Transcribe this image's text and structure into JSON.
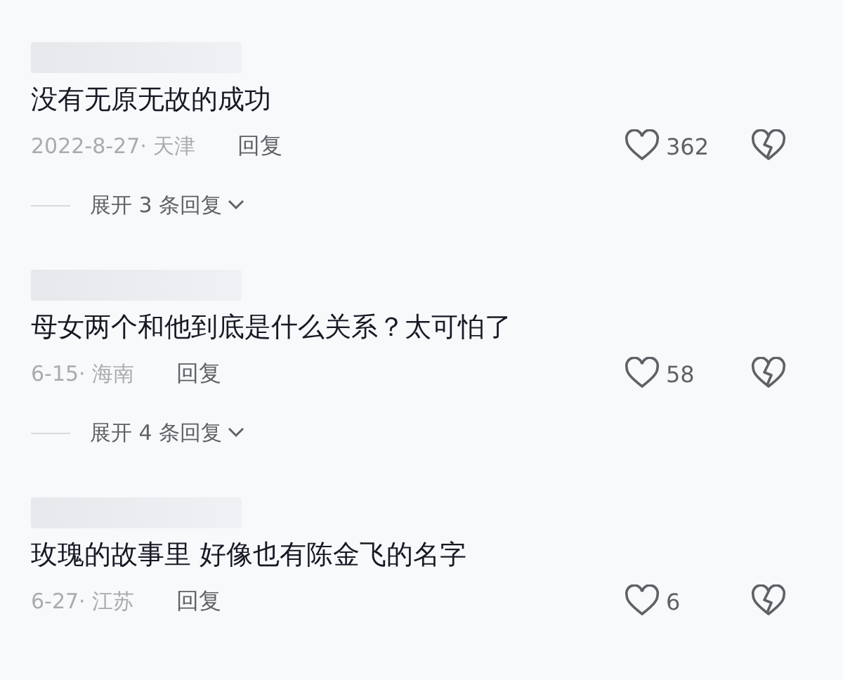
{
  "comments": [
    {
      "text": "没有无原无故的成功",
      "date": "2022-8-27·",
      "location": "天津",
      "reply": "回复",
      "likes": "362",
      "expand": "展开 3 条回复"
    },
    {
      "text": "母女两个和他到底是什么关系？太可怕了",
      "date": "6-15·",
      "location": "海南",
      "reply": "回复",
      "likes": "58",
      "expand": "展开 4 条回复"
    },
    {
      "text": "玫瑰的故事里  好像也有陈金飞的名字",
      "date": "6-27·",
      "location": "江苏",
      "reply": "回复",
      "likes": "6"
    }
  ]
}
